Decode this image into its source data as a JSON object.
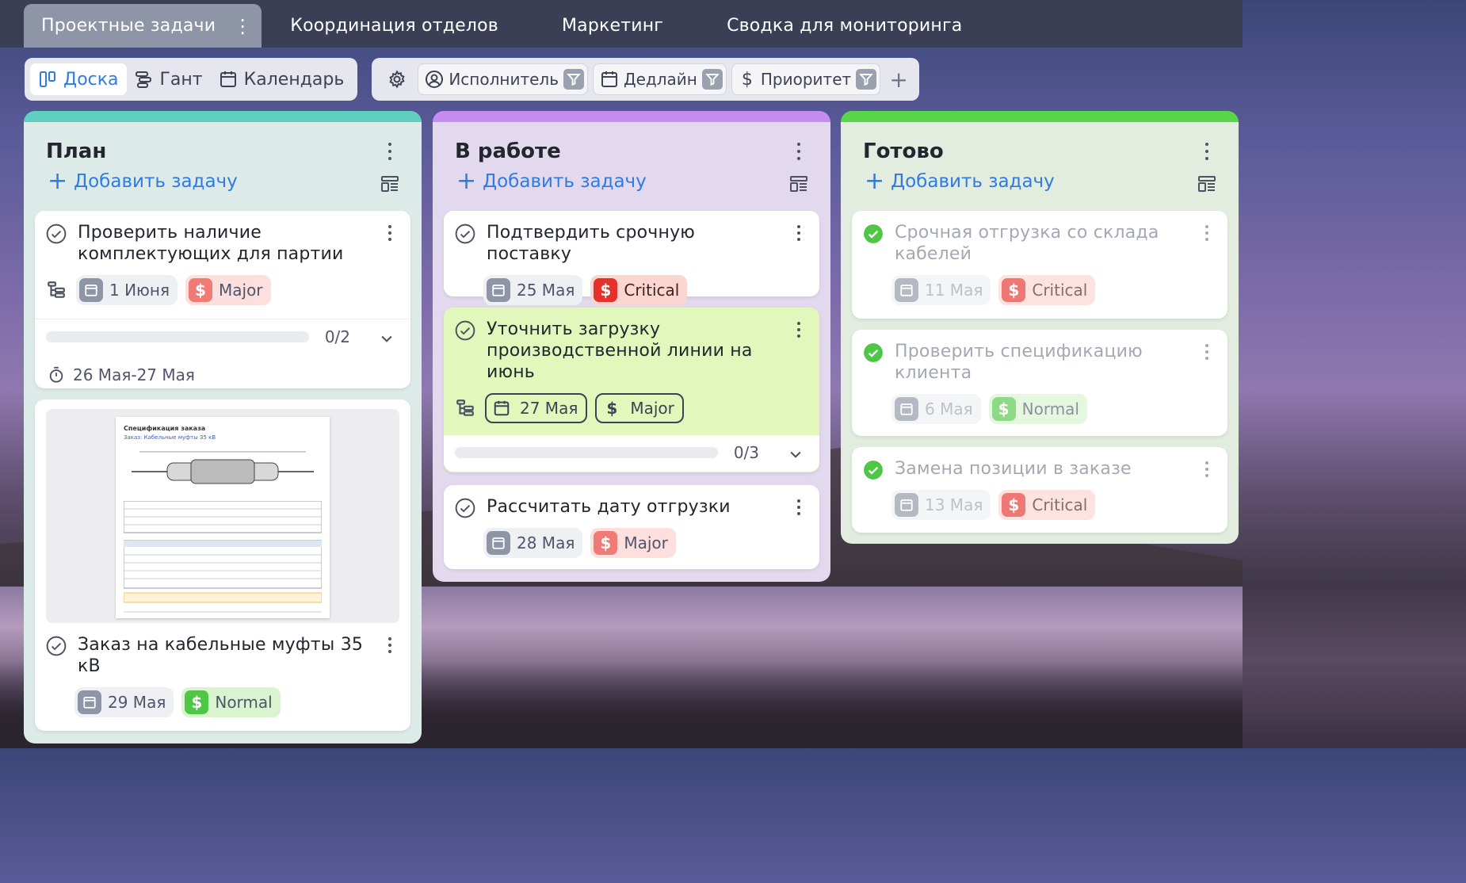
{
  "top_tabs": [
    {
      "label": "Проектные задачи",
      "active": true
    },
    {
      "label": "Координация отделов"
    },
    {
      "label": "Маркетинг"
    },
    {
      "label": "Сводка для мониторинга"
    }
  ],
  "views": [
    {
      "label": "Доска",
      "icon": "board-icon",
      "active": true
    },
    {
      "label": "Гант",
      "icon": "gantt-icon"
    },
    {
      "label": "Календарь",
      "icon": "calendar-icon"
    }
  ],
  "filters": [
    {
      "label": "Исполнитель",
      "icon": "user-icon"
    },
    {
      "label": "Дедлайн",
      "icon": "calendar-icon"
    },
    {
      "label": "Приоритет",
      "icon": "dollar-icon"
    }
  ],
  "add_task_label": "Добавить задачу",
  "columns": {
    "plan": {
      "title": "План",
      "accent": "#5fcfc0",
      "cards": [
        {
          "title": "Проверить наличие комплектующих для партии",
          "date": "1 Июня",
          "priority": "Major",
          "progress": "0/2",
          "progress_value": 0,
          "time_range": "26 Мая-27 Мая"
        },
        {
          "title": "Заказ на кабельные муфты 35 кВ",
          "date": "29 Мая",
          "priority": "Normal",
          "attachment": {
            "doc_title": "Спецификация заказа",
            "doc_subtitle": "Заказ: Кабельные муфты 35 кВ"
          }
        }
      ]
    },
    "work": {
      "title": "В работе",
      "accent": "#c58cf2",
      "cards": [
        {
          "title": "Подтвердить срочную поставку",
          "date": "25 Мая",
          "priority": "Critical"
        },
        {
          "title": "Уточнить загрузку производственной линии на июнь",
          "date": "27 Мая",
          "priority": "Major",
          "progress": "0/3",
          "progress_value": 0
        },
        {
          "title": "Рассчитать дату отгрузки",
          "date": "28 Мая",
          "priority": "Major"
        }
      ]
    },
    "done": {
      "title": "Готово",
      "accent": "#58d64a",
      "cards": [
        {
          "title": "Срочная отгрузка со склада кабелей",
          "date": "11 Мая",
          "priority": "Critical"
        },
        {
          "title": "Проверить спецификацию клиента",
          "date": "6 Мая",
          "priority": "Normal"
        },
        {
          "title": "Замена позиции в заказе",
          "date": "13 Мая",
          "priority": "Critical"
        }
      ]
    }
  }
}
